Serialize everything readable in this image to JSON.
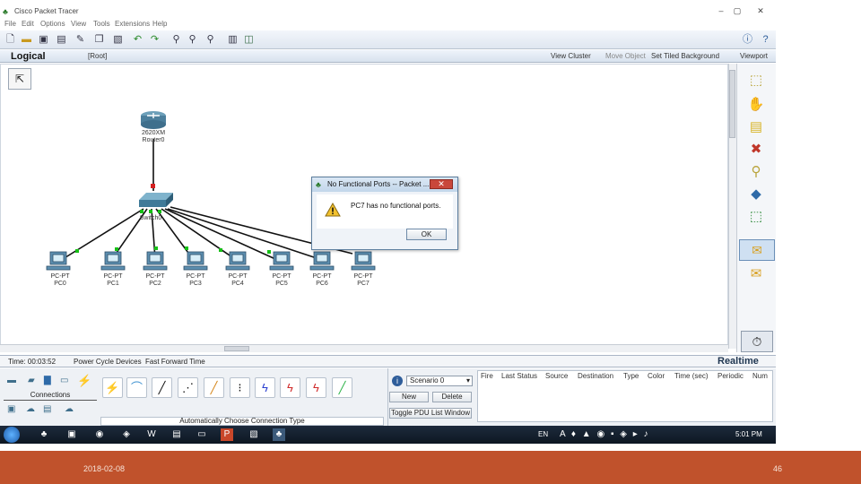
{
  "window": {
    "title": "Cisco Packet Tracer",
    "buttons": [
      "–",
      "▢",
      "✕"
    ]
  },
  "menu": [
    "File",
    "Edit",
    "Options",
    "View",
    "Tools",
    "Extensions",
    "Help"
  ],
  "toolbar": {
    "icons": [
      "new-icon",
      "open-icon",
      "save-icon",
      "print-icon",
      "activity-wizard-icon",
      "copy-icon",
      "paste-icon",
      "undo-icon",
      "redo-icon",
      "zoom-in-icon",
      "zoom-reset-icon",
      "zoom-out-icon",
      "palette-icon",
      "custom-device-icon",
      "info-icon",
      "help-icon"
    ]
  },
  "logical_bar": {
    "label": "Logical",
    "root": "[Root]",
    "view_cluster": "View Cluster",
    "move_object": "Move Object",
    "set_tiled_background": "Set Tiled Background",
    "viewport": "Viewport"
  },
  "topology": {
    "router": {
      "model": "2620XM",
      "name": "Router0"
    },
    "switch": {
      "name": "Switch0"
    },
    "pcs": [
      {
        "model": "PC-PT",
        "name": "PC0"
      },
      {
        "model": "PC-PT",
        "name": "PC1"
      },
      {
        "model": "PC-PT",
        "name": "PC2"
      },
      {
        "model": "PC-PT",
        "name": "PC3"
      },
      {
        "model": "PC-PT",
        "name": "PC4"
      },
      {
        "model": "PC-PT",
        "name": "PC5"
      },
      {
        "model": "PC-PT",
        "name": "PC6"
      },
      {
        "model": "PC-PT",
        "name": "PC7"
      }
    ]
  },
  "dialog": {
    "title": "No Functional Ports -- Packet ...",
    "close": "✕",
    "message": "PC7 has no functional ports.",
    "ok": "OK"
  },
  "status": {
    "time": "Time: 00:03:52",
    "power_cycle": "Power Cycle Devices",
    "fast_forward": "Fast Forward Time",
    "realtime": "Realtime"
  },
  "bottom": {
    "category": "Connections",
    "hint": "Automatically Choose Connection Type",
    "scenario": "Scenario 0",
    "new": "New",
    "delete": "Delete",
    "toggle_pdu": "Toggle PDU List Window",
    "pdu_headers": [
      "Fire",
      "Last Status",
      "Source",
      "Destination",
      "Type",
      "Color",
      "Time (sec)",
      "Periodic",
      "Num"
    ]
  },
  "taskbar": {
    "tray": "EN",
    "clock": "5:01 PM"
  },
  "footer": {
    "date": "2018-02-08",
    "page": "46"
  },
  "colors": {
    "footer_bg": "#c0522c",
    "accent": "#1e3550",
    "link_green": "#16c016"
  }
}
